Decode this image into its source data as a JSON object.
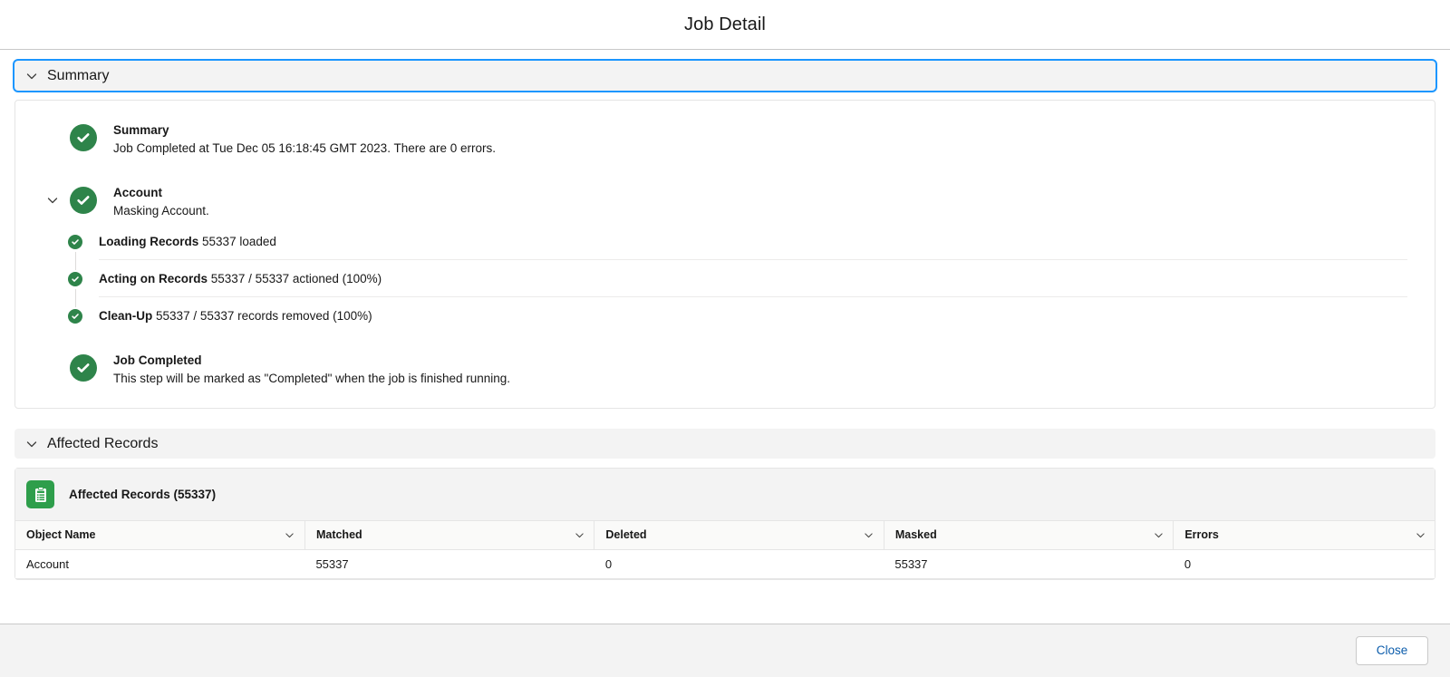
{
  "header": {
    "title": "Job Detail"
  },
  "sections": {
    "summary": {
      "label": "Summary",
      "chevron_icon": "chevron-down-icon"
    },
    "affected_records": {
      "label": "Affected Records",
      "chevron_icon": "chevron-down-icon"
    }
  },
  "summary_steps": [
    {
      "title": "Summary",
      "desc": "Job Completed at Tue Dec 05 16:18:45 GMT 2023. There are 0 errors.",
      "status_icon": "success-check-icon"
    },
    {
      "title": "Account",
      "desc": "Masking Account.",
      "status_icon": "success-check-icon",
      "toggle_icon": "chevron-down-icon"
    },
    {
      "title": "Job Completed",
      "desc": "This step will be marked as \"Completed\" when the job is finished running.",
      "status_icon": "success-check-icon"
    }
  ],
  "substeps": [
    {
      "title": "Loading Records",
      "detail": "55337 loaded",
      "status_icon": "success-check-icon"
    },
    {
      "title": "Acting on Records",
      "detail": "55337 / 55337 actioned (100%)",
      "status_icon": "success-check-icon"
    },
    {
      "title": "Clean-Up",
      "detail": "55337 / 55337 records removed (100%)",
      "status_icon": "success-check-icon"
    }
  ],
  "records_panel": {
    "icon": "records-clipboard-icon",
    "title": "Affected Records (55337)",
    "columns": [
      {
        "label": "Object Name",
        "menu_icon": "chevron-down-icon"
      },
      {
        "label": "Matched",
        "menu_icon": "chevron-down-icon"
      },
      {
        "label": "Deleted",
        "menu_icon": "chevron-down-icon"
      },
      {
        "label": "Masked",
        "menu_icon": "chevron-down-icon"
      },
      {
        "label": "Errors",
        "menu_icon": "chevron-down-icon"
      }
    ],
    "rows": [
      {
        "object_name": "Account",
        "matched": "55337",
        "deleted": "0",
        "masked": "55337",
        "errors": "0"
      }
    ]
  },
  "footer": {
    "close_label": "Close"
  },
  "colors": {
    "success_green": "#2e844a",
    "records_green": "#2e9e4b",
    "link_blue": "#0b5cab",
    "focus_blue": "#1b96ff",
    "panel_gray": "#f3f3f3"
  }
}
